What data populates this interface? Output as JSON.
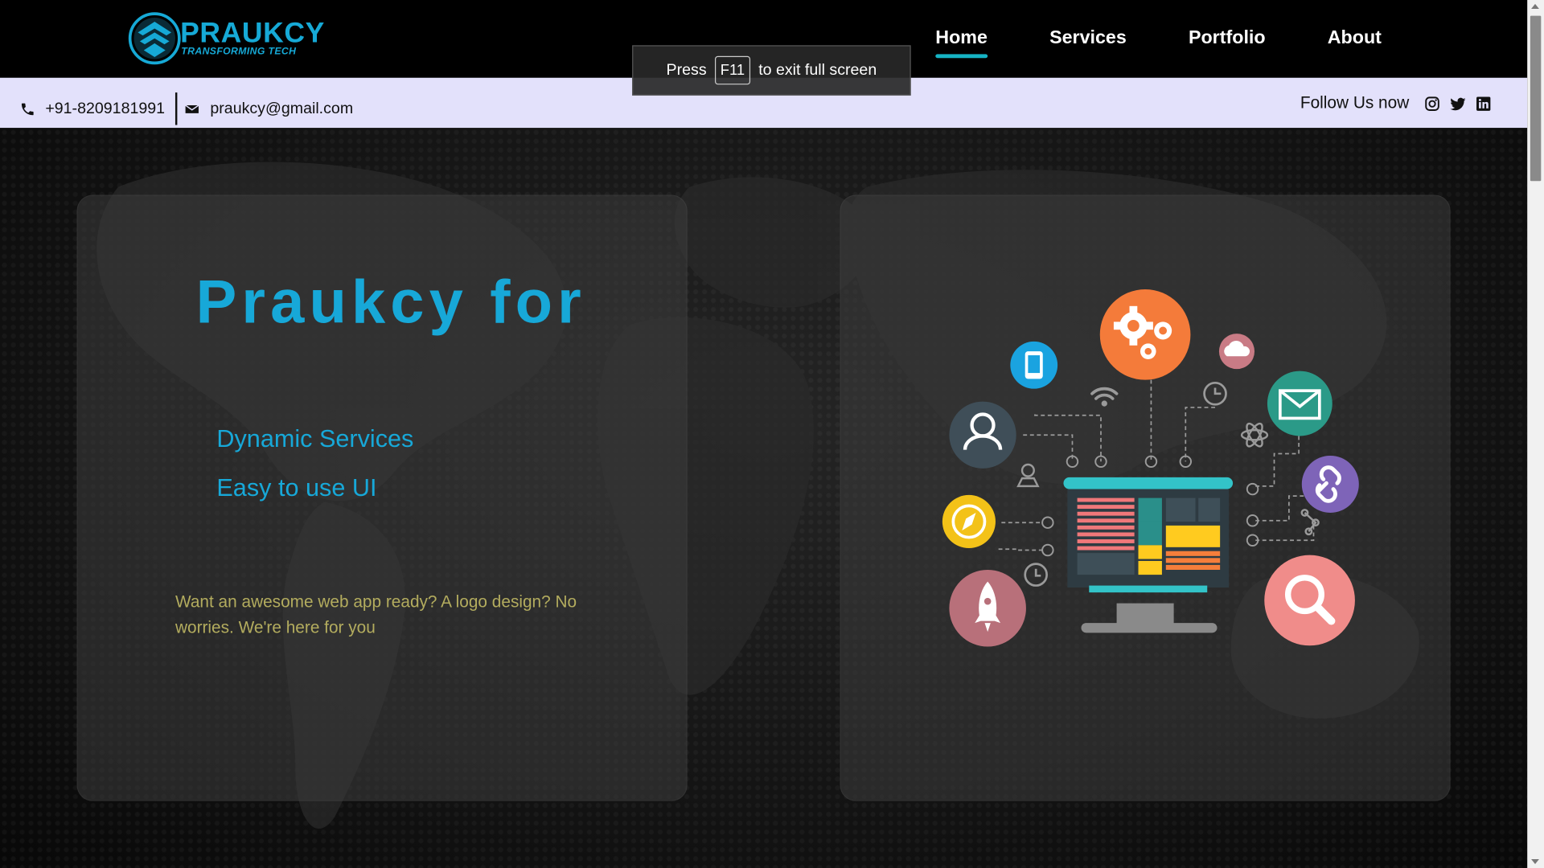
{
  "brand": {
    "name": "PRAUKCY",
    "tagline": "TRANSFORMING TECH",
    "color": "#16a9d6"
  },
  "nav": {
    "items": [
      {
        "label": "Home",
        "active": true
      },
      {
        "label": "Services",
        "active": false
      },
      {
        "label": "Portfolio",
        "active": false
      },
      {
        "label": "About",
        "active": false
      }
    ]
  },
  "fullscreen_notice": {
    "before": "Press",
    "key": "F11",
    "after": "to exit full screen"
  },
  "infobar": {
    "phone": "+91-8209181991",
    "email": "praukcy@gmail.com",
    "follow_label": "Follow Us now",
    "social_icons": [
      "instagram-icon",
      "twitter-icon",
      "linkedin-icon"
    ]
  },
  "hero": {
    "title": "Praukcy for",
    "features": [
      "Dynamic Services",
      "Easy to use UI"
    ],
    "tagline": "Want an awesome web app ready? A logo design? No worries. We're here for you",
    "illustration_icons": [
      "gears-icon",
      "mobile-icon",
      "cloud-wifi-icon",
      "user-icon",
      "mail-icon",
      "link-icon",
      "compass-icon",
      "rocket-icon",
      "search-icon",
      "monitor-icon",
      "wifi-icon",
      "atom-icon",
      "map-pin-icon",
      "clock-icon"
    ]
  },
  "colors": {
    "accent": "#17a8d8",
    "tagline": "#b3ac5e",
    "infobar_bg": "#e3e1fb",
    "active_underline": "#16b3c4"
  }
}
